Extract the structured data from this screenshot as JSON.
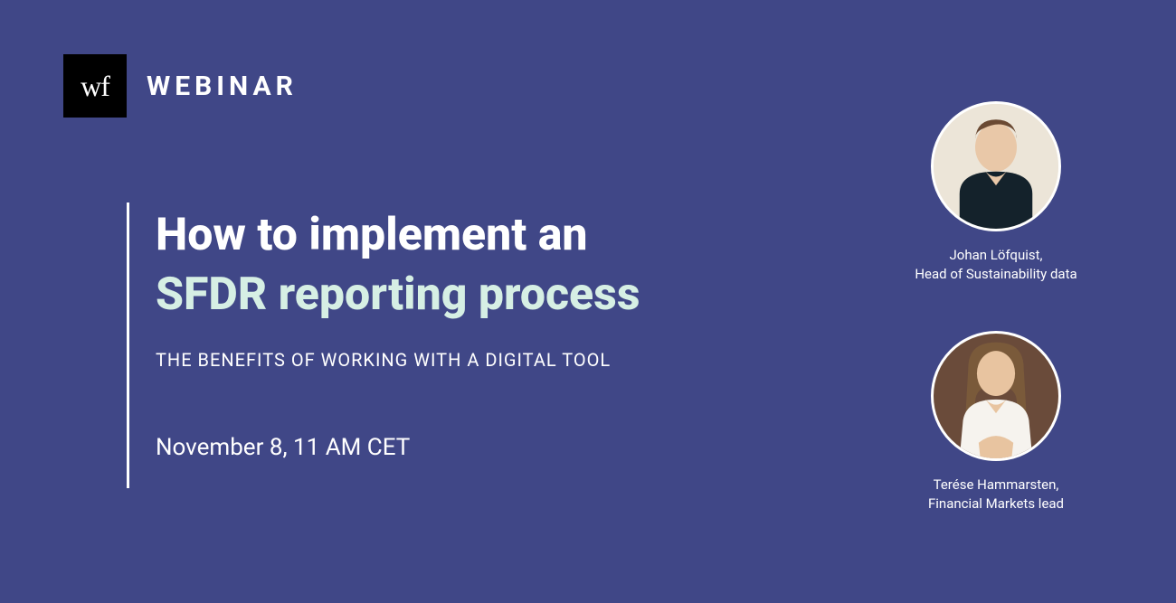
{
  "brand": {
    "logo_text": "wf",
    "label": "WEBINAR"
  },
  "title": {
    "line1": "How to implement an",
    "line2": "SFDR reporting process"
  },
  "subtitle": "THE BENEFITS OF WORKING WITH A DIGITAL TOOL",
  "datetime": "November 8, 11 AM CET",
  "speakers": [
    {
      "name": "Johan Löfquist,",
      "role": "Head of Sustainability data"
    },
    {
      "name": "Terése Hammarsten,",
      "role": "Financial Markets lead"
    }
  ]
}
